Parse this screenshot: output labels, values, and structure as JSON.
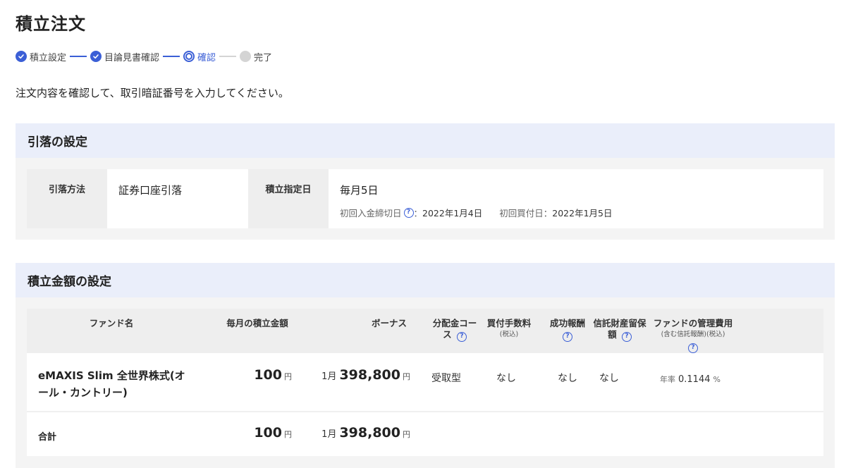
{
  "page": {
    "title": "積立注文",
    "instruction": "注文内容を確認して、取引暗証番号を入力してください。"
  },
  "stepper": {
    "steps": [
      {
        "label": "積立設定",
        "state": "done"
      },
      {
        "label": "目論見書確認",
        "state": "done"
      },
      {
        "label": "確認",
        "state": "current"
      },
      {
        "label": "完了",
        "state": "todo"
      }
    ]
  },
  "withdrawal": {
    "section_title": "引落の設定",
    "method_label": "引落方法",
    "method_value": "証券口座引落",
    "date_label": "積立指定日",
    "date_value": "毎月5日",
    "first_deposit_label": "初回入金締切日",
    "first_deposit_date": "2022年1月4日",
    "first_purchase_label": "初回買付日",
    "first_purchase_date": "2022年1月5日",
    "separator": "："
  },
  "amount": {
    "section_title": "積立金額の設定",
    "headers": {
      "fund_name": "ファンド名",
      "monthly": "毎月の積立金額",
      "bonus": "ボーナス",
      "distribution": "分配金コース",
      "purchase_fee": "買付手数料",
      "purchase_fee_note": "(税込)",
      "success_fee": "成功報酬",
      "trust_reserve": "信託財産留保額",
      "mgmt_fee": "ファンドの管理費用",
      "mgmt_fee_note": "(含む信託報酬)(税込)"
    },
    "row": {
      "fund_name": "eMAXIS Slim 全世界株式(オール・カントリー)",
      "monthly_amount": "100",
      "yen": "円",
      "bonus_month": "1月",
      "bonus_amount": "398,800",
      "distribution": "受取型",
      "purchase_fee": "なし",
      "success_fee": "なし",
      "trust_reserve": "なし",
      "rate_prefix": "年率",
      "mgmt_rate": "0.1144",
      "pct": "%"
    },
    "total": {
      "label": "合計",
      "monthly_amount": "100",
      "bonus_month": "1月",
      "bonus_amount": "398,800"
    }
  },
  "colors": {
    "accent": "#3b5fd6",
    "section_header_bg": "#eaeefa",
    "label_bg": "#eeeeee"
  }
}
